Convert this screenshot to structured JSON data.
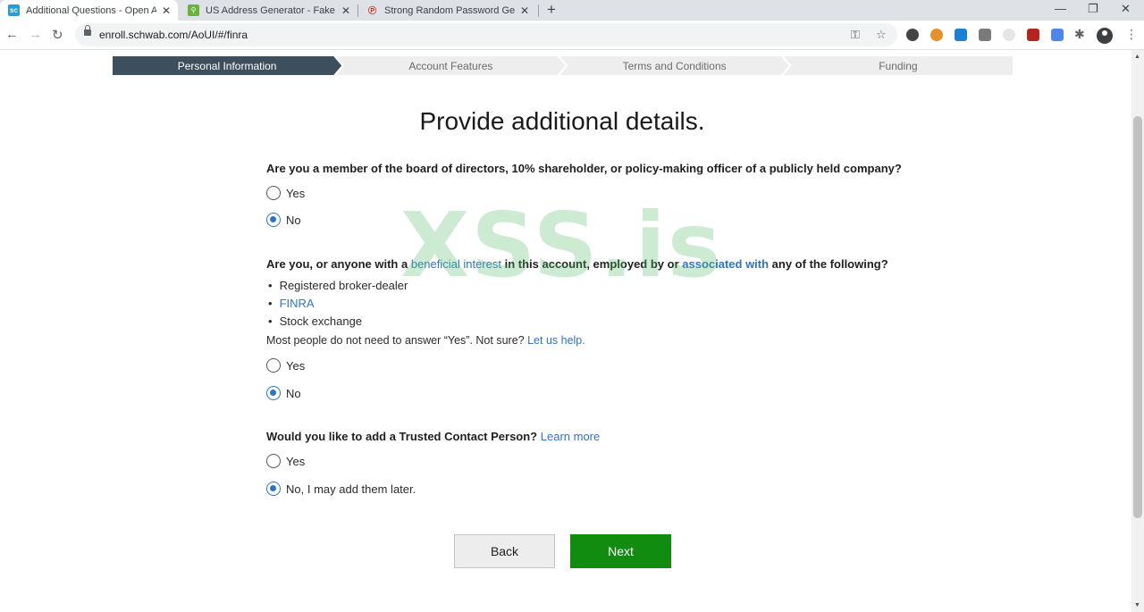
{
  "browser": {
    "tabs": [
      {
        "label": "Additional Questions - Open Acc",
        "active": true,
        "favicon": "schwab-icon",
        "favicon_color": "#2a9bd6"
      },
      {
        "label": "US Address Generator - Fake Ad",
        "active": false,
        "favicon": "address-generator-icon",
        "favicon_color": "#6ab43c"
      },
      {
        "label": "Strong Random Password Gener",
        "active": false,
        "favicon": "password-generator-icon",
        "favicon_color": "#c4321b"
      }
    ],
    "url": "enroll.schwab.com/AoUI/#/finra"
  },
  "progress_steps": [
    {
      "label": "Personal Information",
      "current": true
    },
    {
      "label": "Account Features",
      "current": false
    },
    {
      "label": "Terms and Conditions",
      "current": false
    },
    {
      "label": "Funding",
      "current": false
    }
  ],
  "page": {
    "heading": "Provide additional details.",
    "watermark": "XSS.is"
  },
  "q1": {
    "text": "Are you a member of the board of directors, 10% shareholder, or policy-making officer of a publicly held company?",
    "options": [
      {
        "label": "Yes",
        "selected": false
      },
      {
        "label": "No",
        "selected": true
      }
    ]
  },
  "q2": {
    "text_pre": "Are you, or anyone with a ",
    "link1": "beneficial interest",
    "text_mid": " in this account, employed by or ",
    "link2": "associated with",
    "text_post": " any of the following?",
    "bullets": [
      "Registered broker-dealer",
      "FINRA",
      "Stock exchange"
    ],
    "note_text": "Most people do not need to answer “Yes”. Not sure?",
    "note_link": "Let us help.",
    "options": [
      {
        "label": "Yes",
        "selected": false
      },
      {
        "label": "No",
        "selected": true
      }
    ]
  },
  "q3": {
    "text": "Would you like to add a Trusted Contact Person?",
    "link": "Learn more",
    "options": [
      {
        "label": "Yes",
        "selected": false
      },
      {
        "label": "No, I may add them later.",
        "selected": true
      }
    ]
  },
  "buttons": {
    "back": "Back",
    "next": "Next"
  },
  "colors": {
    "accent_blue": "#2f74c0",
    "next_green": "#128b11",
    "current_step": "#3d4e5c"
  }
}
